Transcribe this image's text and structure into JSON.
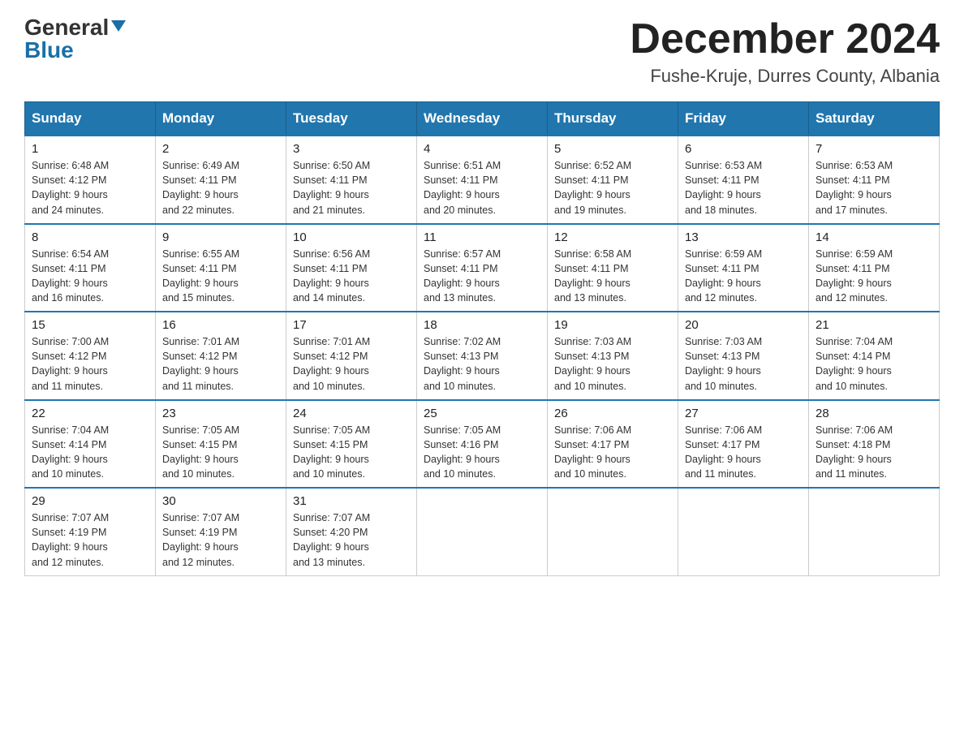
{
  "header": {
    "logo_general": "General",
    "logo_blue": "Blue",
    "month_title": "December 2024",
    "location": "Fushe-Kruje, Durres County, Albania"
  },
  "days_of_week": [
    "Sunday",
    "Monday",
    "Tuesday",
    "Wednesday",
    "Thursday",
    "Friday",
    "Saturday"
  ],
  "weeks": [
    [
      {
        "day": "1",
        "sunrise": "6:48 AM",
        "sunset": "4:12 PM",
        "daylight": "9 hours and 24 minutes."
      },
      {
        "day": "2",
        "sunrise": "6:49 AM",
        "sunset": "4:11 PM",
        "daylight": "9 hours and 22 minutes."
      },
      {
        "day": "3",
        "sunrise": "6:50 AM",
        "sunset": "4:11 PM",
        "daylight": "9 hours and 21 minutes."
      },
      {
        "day": "4",
        "sunrise": "6:51 AM",
        "sunset": "4:11 PM",
        "daylight": "9 hours and 20 minutes."
      },
      {
        "day": "5",
        "sunrise": "6:52 AM",
        "sunset": "4:11 PM",
        "daylight": "9 hours and 19 minutes."
      },
      {
        "day": "6",
        "sunrise": "6:53 AM",
        "sunset": "4:11 PM",
        "daylight": "9 hours and 18 minutes."
      },
      {
        "day": "7",
        "sunrise": "6:53 AM",
        "sunset": "4:11 PM",
        "daylight": "9 hours and 17 minutes."
      }
    ],
    [
      {
        "day": "8",
        "sunrise": "6:54 AM",
        "sunset": "4:11 PM",
        "daylight": "9 hours and 16 minutes."
      },
      {
        "day": "9",
        "sunrise": "6:55 AM",
        "sunset": "4:11 PM",
        "daylight": "9 hours and 15 minutes."
      },
      {
        "day": "10",
        "sunrise": "6:56 AM",
        "sunset": "4:11 PM",
        "daylight": "9 hours and 14 minutes."
      },
      {
        "day": "11",
        "sunrise": "6:57 AM",
        "sunset": "4:11 PM",
        "daylight": "9 hours and 13 minutes."
      },
      {
        "day": "12",
        "sunrise": "6:58 AM",
        "sunset": "4:11 PM",
        "daylight": "9 hours and 13 minutes."
      },
      {
        "day": "13",
        "sunrise": "6:59 AM",
        "sunset": "4:11 PM",
        "daylight": "9 hours and 12 minutes."
      },
      {
        "day": "14",
        "sunrise": "6:59 AM",
        "sunset": "4:11 PM",
        "daylight": "9 hours and 12 minutes."
      }
    ],
    [
      {
        "day": "15",
        "sunrise": "7:00 AM",
        "sunset": "4:12 PM",
        "daylight": "9 hours and 11 minutes."
      },
      {
        "day": "16",
        "sunrise": "7:01 AM",
        "sunset": "4:12 PM",
        "daylight": "9 hours and 11 minutes."
      },
      {
        "day": "17",
        "sunrise": "7:01 AM",
        "sunset": "4:12 PM",
        "daylight": "9 hours and 10 minutes."
      },
      {
        "day": "18",
        "sunrise": "7:02 AM",
        "sunset": "4:13 PM",
        "daylight": "9 hours and 10 minutes."
      },
      {
        "day": "19",
        "sunrise": "7:03 AM",
        "sunset": "4:13 PM",
        "daylight": "9 hours and 10 minutes."
      },
      {
        "day": "20",
        "sunrise": "7:03 AM",
        "sunset": "4:13 PM",
        "daylight": "9 hours and 10 minutes."
      },
      {
        "day": "21",
        "sunrise": "7:04 AM",
        "sunset": "4:14 PM",
        "daylight": "9 hours and 10 minutes."
      }
    ],
    [
      {
        "day": "22",
        "sunrise": "7:04 AM",
        "sunset": "4:14 PM",
        "daylight": "9 hours and 10 minutes."
      },
      {
        "day": "23",
        "sunrise": "7:05 AM",
        "sunset": "4:15 PM",
        "daylight": "9 hours and 10 minutes."
      },
      {
        "day": "24",
        "sunrise": "7:05 AM",
        "sunset": "4:15 PM",
        "daylight": "9 hours and 10 minutes."
      },
      {
        "day": "25",
        "sunrise": "7:05 AM",
        "sunset": "4:16 PM",
        "daylight": "9 hours and 10 minutes."
      },
      {
        "day": "26",
        "sunrise": "7:06 AM",
        "sunset": "4:17 PM",
        "daylight": "9 hours and 10 minutes."
      },
      {
        "day": "27",
        "sunrise": "7:06 AM",
        "sunset": "4:17 PM",
        "daylight": "9 hours and 11 minutes."
      },
      {
        "day": "28",
        "sunrise": "7:06 AM",
        "sunset": "4:18 PM",
        "daylight": "9 hours and 11 minutes."
      }
    ],
    [
      {
        "day": "29",
        "sunrise": "7:07 AM",
        "sunset": "4:19 PM",
        "daylight": "9 hours and 12 minutes."
      },
      {
        "day": "30",
        "sunrise": "7:07 AM",
        "sunset": "4:19 PM",
        "daylight": "9 hours and 12 minutes."
      },
      {
        "day": "31",
        "sunrise": "7:07 AM",
        "sunset": "4:20 PM",
        "daylight": "9 hours and 13 minutes."
      },
      null,
      null,
      null,
      null
    ]
  ],
  "labels": {
    "sunrise": "Sunrise:",
    "sunset": "Sunset:",
    "daylight": "Daylight:"
  }
}
